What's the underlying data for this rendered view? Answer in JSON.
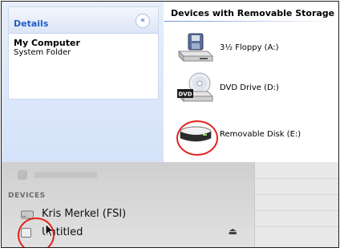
{
  "details_pane": {
    "title": "Details",
    "collapse_glyph": "«",
    "item_name": "My Computer",
    "item_type": "System Folder"
  },
  "devices_pane": {
    "header": "Devices with Removable Storage",
    "items": [
      {
        "label": "3½ Floppy (A:)",
        "icon": "floppy-drive-icon"
      },
      {
        "label": "DVD Drive (D:)",
        "icon": "dvd-drive-icon",
        "badge": "DVD"
      },
      {
        "label": "Removable Disk (E:)",
        "icon": "removable-disk-icon"
      }
    ]
  },
  "mac_sidebar": {
    "section_label": "DEVICES",
    "items": [
      {
        "label": "Kris Merkel (FSI)",
        "icon": "hard-drive-icon"
      },
      {
        "label": "Untitled",
        "icon": "external-disk-icon",
        "eject": "⏏"
      }
    ]
  },
  "colors": {
    "highlight_circle": "#e3241c",
    "xp_blue": "#215dc6"
  }
}
